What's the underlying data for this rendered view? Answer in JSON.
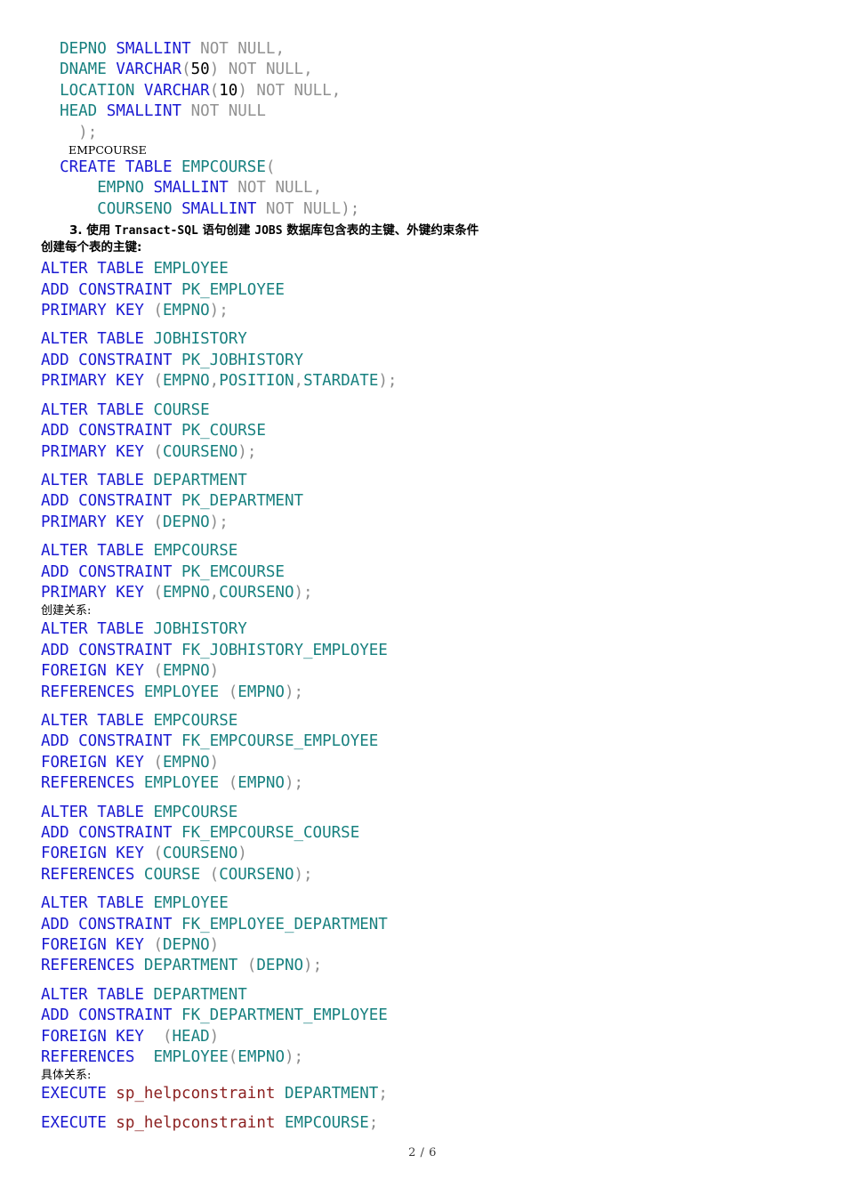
{
  "document": {
    "footer_page": "2 / 6"
  },
  "top_create_table": {
    "lines": [
      {
        "indent": 2,
        "tokens": [
          {
            "t": "DEPNO",
            "c": "idn"
          },
          {
            "t": " ",
            "c": "pun"
          },
          {
            "t": "SMALLINT",
            "c": "kw"
          },
          {
            "t": " ",
            "c": "pun"
          },
          {
            "t": "NOT NULL,",
            "c": "gry"
          }
        ]
      },
      {
        "indent": 2,
        "tokens": [
          {
            "t": "DNAME",
            "c": "idn"
          },
          {
            "t": " ",
            "c": "pun"
          },
          {
            "t": "VARCHAR",
            "c": "kw"
          },
          {
            "t": "(",
            "c": "pun"
          },
          {
            "t": "50",
            "c": "num"
          },
          {
            "t": ")",
            "c": "pun"
          },
          {
            "t": " ",
            "c": "pun"
          },
          {
            "t": "NOT NULL,",
            "c": "gry"
          }
        ]
      },
      {
        "indent": 2,
        "tokens": [
          {
            "t": "LOCATION",
            "c": "idn"
          },
          {
            "t": " ",
            "c": "pun"
          },
          {
            "t": "VARCHAR",
            "c": "kw"
          },
          {
            "t": "(",
            "c": "pun"
          },
          {
            "t": "10",
            "c": "num"
          },
          {
            "t": ")",
            "c": "pun"
          },
          {
            "t": " ",
            "c": "pun"
          },
          {
            "t": "NOT NULL,",
            "c": "gry"
          }
        ]
      },
      {
        "indent": 2,
        "tokens": [
          {
            "t": "HEAD",
            "c": "idn"
          },
          {
            "t": " ",
            "c": "pun"
          },
          {
            "t": "SMALLINT",
            "c": "kw"
          },
          {
            "t": " ",
            "c": "pun"
          },
          {
            "t": "NOT NULL",
            "c": "gry"
          }
        ]
      },
      {
        "indent": 4,
        "tokens": [
          {
            "t": ");",
            "c": "pun"
          }
        ]
      }
    ]
  },
  "empcourse_caption": "EMPCOURSE",
  "empcourse_create": {
    "lines": [
      {
        "indent": 2,
        "tokens": [
          {
            "t": "CREATE TABLE ",
            "c": "kw"
          },
          {
            "t": "EMPCOURSE",
            "c": "idn"
          },
          {
            "t": "(",
            "c": "pun"
          }
        ]
      },
      {
        "indent": 6,
        "tokens": [
          {
            "t": "EMPNO",
            "c": "idn"
          },
          {
            "t": " ",
            "c": "pun"
          },
          {
            "t": "SMALLINT",
            "c": "kw"
          },
          {
            "t": " ",
            "c": "pun"
          },
          {
            "t": "NOT NULL,",
            "c": "gry"
          }
        ]
      },
      {
        "indent": 6,
        "tokens": [
          {
            "t": "COURSENO",
            "c": "idn"
          },
          {
            "t": " ",
            "c": "pun"
          },
          {
            "t": "SMALLINT",
            "c": "kw"
          },
          {
            "t": " ",
            "c": "pun"
          },
          {
            "t": "NOT NULL",
            "c": "gry"
          },
          {
            "t": ");",
            "c": "pun"
          }
        ]
      }
    ]
  },
  "section3": {
    "number": "3.",
    "text_before": " 使用 ",
    "mono1": "Transact-SQL",
    "text_mid": " 语句创建 ",
    "mono2": "JOBS",
    "text_after": " 数据库包含表的主键、外键约束条件",
    "subtitle": "创建每个表的主键:"
  },
  "primary_keys": [
    {
      "lines": [
        {
          "tokens": [
            {
              "t": "ALTER TABLE ",
              "c": "kw"
            },
            {
              "t": "EMPLOYEE",
              "c": "idn"
            }
          ]
        },
        {
          "tokens": [
            {
              "t": "ADD CONSTRAINT ",
              "c": "kw"
            },
            {
              "t": "PK_EMPLOYEE",
              "c": "idn"
            }
          ]
        },
        {
          "tokens": [
            {
              "t": "PRIMARY KEY ",
              "c": "kw"
            },
            {
              "t": "(",
              "c": "pun"
            },
            {
              "t": "EMPNO",
              "c": "idn"
            },
            {
              "t": ");",
              "c": "pun"
            }
          ]
        }
      ]
    },
    {
      "lines": [
        {
          "tokens": [
            {
              "t": "ALTER TABLE ",
              "c": "kw"
            },
            {
              "t": "JOBHISTORY",
              "c": "idn"
            }
          ]
        },
        {
          "tokens": [
            {
              "t": "ADD CONSTRAINT ",
              "c": "kw"
            },
            {
              "t": "PK_JOBHISTORY",
              "c": "idn"
            }
          ]
        },
        {
          "tokens": [
            {
              "t": "PRIMARY KEY ",
              "c": "kw"
            },
            {
              "t": "(",
              "c": "pun"
            },
            {
              "t": "EMPNO",
              "c": "idn"
            },
            {
              "t": ",",
              "c": "pun"
            },
            {
              "t": "POSITION",
              "c": "idn"
            },
            {
              "t": ",",
              "c": "pun"
            },
            {
              "t": "STARDATE",
              "c": "idn"
            },
            {
              "t": ");",
              "c": "pun"
            }
          ]
        }
      ]
    },
    {
      "lines": [
        {
          "tokens": [
            {
              "t": "ALTER TABLE ",
              "c": "kw"
            },
            {
              "t": "COURSE",
              "c": "idn"
            }
          ]
        },
        {
          "tokens": [
            {
              "t": "ADD CONSTRAINT ",
              "c": "kw"
            },
            {
              "t": "PK_COURSE",
              "c": "idn"
            }
          ]
        },
        {
          "tokens": [
            {
              "t": "PRIMARY KEY ",
              "c": "kw"
            },
            {
              "t": "(",
              "c": "pun"
            },
            {
              "t": "COURSENO",
              "c": "idn"
            },
            {
              "t": ");",
              "c": "pun"
            }
          ]
        }
      ]
    },
    {
      "lines": [
        {
          "tokens": [
            {
              "t": "ALTER TABLE ",
              "c": "kw"
            },
            {
              "t": "DEPARTMENT",
              "c": "idn"
            }
          ]
        },
        {
          "tokens": [
            {
              "t": "ADD CONSTRAINT ",
              "c": "kw"
            },
            {
              "t": "PK_DEPARTMENT",
              "c": "idn"
            }
          ]
        },
        {
          "tokens": [
            {
              "t": "PRIMARY KEY ",
              "c": "kw"
            },
            {
              "t": "(",
              "c": "pun"
            },
            {
              "t": "DEPNO",
              "c": "idn"
            },
            {
              "t": ");",
              "c": "pun"
            }
          ]
        }
      ]
    },
    {
      "lines": [
        {
          "tokens": [
            {
              "t": "ALTER TABLE ",
              "c": "kw"
            },
            {
              "t": "EMPCOURSE",
              "c": "idn"
            }
          ]
        },
        {
          "tokens": [
            {
              "t": "ADD CONSTRAINT ",
              "c": "kw"
            },
            {
              "t": "PK_EMCOURSE",
              "c": "idn"
            }
          ]
        },
        {
          "tokens": [
            {
              "t": "PRIMARY KEY ",
              "c": "kw"
            },
            {
              "t": "(",
              "c": "pun"
            },
            {
              "t": "EMPNO",
              "c": "idn"
            },
            {
              "t": ",",
              "c": "pun"
            },
            {
              "t": "COURSENO",
              "c": "idn"
            },
            {
              "t": ");",
              "c": "pun"
            }
          ]
        }
      ]
    }
  ],
  "relations_label": "创建关系:",
  "foreign_keys": [
    {
      "lines": [
        {
          "tokens": [
            {
              "t": "ALTER TABLE ",
              "c": "kw"
            },
            {
              "t": "JOBHISTORY",
              "c": "idn"
            }
          ]
        },
        {
          "tokens": [
            {
              "t": "ADD CONSTRAINT ",
              "c": "kw"
            },
            {
              "t": "FK_JOBHISTORY_EMPLOYEE",
              "c": "idn"
            }
          ]
        },
        {
          "tokens": [
            {
              "t": "FOREIGN KEY ",
              "c": "kw"
            },
            {
              "t": "(",
              "c": "pun"
            },
            {
              "t": "EMPNO",
              "c": "idn"
            },
            {
              "t": ")",
              "c": "pun"
            }
          ]
        },
        {
          "tokens": [
            {
              "t": "REFERENCES ",
              "c": "kw"
            },
            {
              "t": "EMPLOYEE",
              "c": "idn"
            },
            {
              "t": " (",
              "c": "pun"
            },
            {
              "t": "EMPNO",
              "c": "idn"
            },
            {
              "t": ");",
              "c": "pun"
            }
          ]
        }
      ]
    },
    {
      "lines": [
        {
          "tokens": [
            {
              "t": "ALTER TABLE ",
              "c": "kw"
            },
            {
              "t": "EMPCOURSE",
              "c": "idn"
            }
          ]
        },
        {
          "tokens": [
            {
              "t": "ADD CONSTRAINT ",
              "c": "kw"
            },
            {
              "t": "FK_EMPCOURSE_EMPLOYEE",
              "c": "idn"
            }
          ]
        },
        {
          "tokens": [
            {
              "t": "FOREIGN KEY ",
              "c": "kw"
            },
            {
              "t": "(",
              "c": "pun"
            },
            {
              "t": "EMPNO",
              "c": "idn"
            },
            {
              "t": ")",
              "c": "pun"
            }
          ]
        },
        {
          "tokens": [
            {
              "t": "REFERENCES ",
              "c": "kw"
            },
            {
              "t": "EMPLOYEE",
              "c": "idn"
            },
            {
              "t": " (",
              "c": "pun"
            },
            {
              "t": "EMPNO",
              "c": "idn"
            },
            {
              "t": ");",
              "c": "pun"
            }
          ]
        }
      ]
    },
    {
      "lines": [
        {
          "tokens": [
            {
              "t": "ALTER TABLE ",
              "c": "kw"
            },
            {
              "t": "EMPCOURSE",
              "c": "idn"
            }
          ]
        },
        {
          "tokens": [
            {
              "t": "ADD CONSTRAINT ",
              "c": "kw"
            },
            {
              "t": "FK_EMPCOURSE_COURSE",
              "c": "idn"
            }
          ]
        },
        {
          "tokens": [
            {
              "t": "FOREIGN KEY ",
              "c": "kw"
            },
            {
              "t": "(",
              "c": "pun"
            },
            {
              "t": "COURSENO",
              "c": "idn"
            },
            {
              "t": ")",
              "c": "pun"
            }
          ]
        },
        {
          "tokens": [
            {
              "t": "REFERENCES ",
              "c": "kw"
            },
            {
              "t": "COURSE",
              "c": "idn"
            },
            {
              "t": " (",
              "c": "pun"
            },
            {
              "t": "COURSENO",
              "c": "idn"
            },
            {
              "t": ");",
              "c": "pun"
            }
          ]
        }
      ]
    },
    {
      "lines": [
        {
          "tokens": [
            {
              "t": "ALTER TABLE ",
              "c": "kw"
            },
            {
              "t": "EMPLOYEE",
              "c": "idn"
            }
          ]
        },
        {
          "tokens": [
            {
              "t": "ADD CONSTRAINT ",
              "c": "kw"
            },
            {
              "t": "FK_EMPLOYEE_DEPARTMENT",
              "c": "idn"
            }
          ]
        },
        {
          "tokens": [
            {
              "t": "FOREIGN KEY ",
              "c": "kw"
            },
            {
              "t": "(",
              "c": "pun"
            },
            {
              "t": "DEPNO",
              "c": "idn"
            },
            {
              "t": ")",
              "c": "pun"
            }
          ]
        },
        {
          "tokens": [
            {
              "t": "REFERENCES ",
              "c": "kw"
            },
            {
              "t": "DEPARTMENT",
              "c": "idn"
            },
            {
              "t": " (",
              "c": "pun"
            },
            {
              "t": "DEPNO",
              "c": "idn"
            },
            {
              "t": ");",
              "c": "pun"
            }
          ]
        }
      ]
    },
    {
      "lines": [
        {
          "tokens": [
            {
              "t": "ALTER TABLE ",
              "c": "kw"
            },
            {
              "t": "DEPARTMENT",
              "c": "idn"
            }
          ]
        },
        {
          "tokens": [
            {
              "t": "ADD CONSTRAINT ",
              "c": "kw"
            },
            {
              "t": "FK_DEPARTMENT_EMPLOYEE",
              "c": "idn"
            }
          ]
        },
        {
          "tokens": [
            {
              "t": "FOREIGN KEY ",
              "c": "kw"
            },
            {
              "t": " (",
              "c": "pun"
            },
            {
              "t": "HEAD",
              "c": "idn"
            },
            {
              "t": ")",
              "c": "pun"
            }
          ]
        },
        {
          "tokens": [
            {
              "t": "REFERENCES ",
              "c": "kw"
            },
            {
              "t": " ",
              "c": "pun"
            },
            {
              "t": "EMPLOYEE",
              "c": "idn"
            },
            {
              "t": "(",
              "c": "pun"
            },
            {
              "t": "EMPNO",
              "c": "idn"
            },
            {
              "t": ");",
              "c": "pun"
            }
          ]
        }
      ]
    }
  ],
  "detail_label": "具体关系:",
  "executes": [
    {
      "lines": [
        {
          "tokens": [
            {
              "t": "EXECUTE ",
              "c": "kw"
            },
            {
              "t": "sp_helpconstraint",
              "c": "proc"
            },
            {
              "t": " ",
              "c": "pun"
            },
            {
              "t": "DEPARTMENT",
              "c": "idn"
            },
            {
              "t": ";",
              "c": "pun"
            }
          ]
        }
      ]
    },
    {
      "lines": [
        {
          "tokens": [
            {
              "t": "EXECUTE ",
              "c": "kw"
            },
            {
              "t": "sp_helpconstraint",
              "c": "proc"
            },
            {
              "t": " ",
              "c": "pun"
            },
            {
              "t": "EMPCOURSE",
              "c": "idn"
            },
            {
              "t": ";",
              "c": "pun"
            }
          ]
        }
      ]
    }
  ]
}
